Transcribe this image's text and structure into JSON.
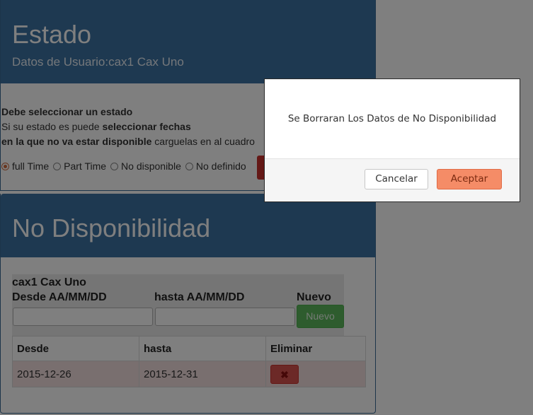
{
  "estado": {
    "title": "Estado",
    "subtitle": "Datos de Usuario:cax1 Cax Uno",
    "instructions": {
      "line1_bold": "Debe seleccionar un estado",
      "line2_pre": "Si su estado es puede ",
      "line2_bold": "seleccionar fechas",
      "line3_bold": "en la que no va estar disponible",
      "line3_post": " carguelas en al cuadro"
    },
    "radios": [
      {
        "label": "full Time",
        "checked": true
      },
      {
        "label": "Part Time",
        "checked": false
      },
      {
        "label": "No disponible",
        "checked": false
      },
      {
        "label": "No definido",
        "checked": false
      }
    ]
  },
  "no_disponibilidad": {
    "title": "No Disponibilidad",
    "form": {
      "user": "cax1 Cax Uno",
      "desde_label": "Desde AA/MM/DD",
      "hasta_label": "hasta AA/MM/DD",
      "nuevo_label": "Nuevo",
      "desde_value": "",
      "hasta_value": "",
      "nuevo_button": "Nuevo"
    },
    "table": {
      "columns": [
        "Desde",
        "hasta",
        "Eliminar"
      ],
      "rows": [
        {
          "desde": "2015-12-26",
          "hasta": "2015-12-31",
          "delete_icon": "✖"
        }
      ]
    }
  },
  "modal": {
    "message": "Se Borraran Los Datos de No Disponibilidad",
    "cancel_label": "Cancelar",
    "accept_label": "Aceptar"
  },
  "colors": {
    "panel_heading": "#3d73a3",
    "success": "#5cb85c",
    "danger": "#d9534f",
    "accept": "#f58c67"
  },
  "icons": {
    "delete": "close-icon"
  }
}
